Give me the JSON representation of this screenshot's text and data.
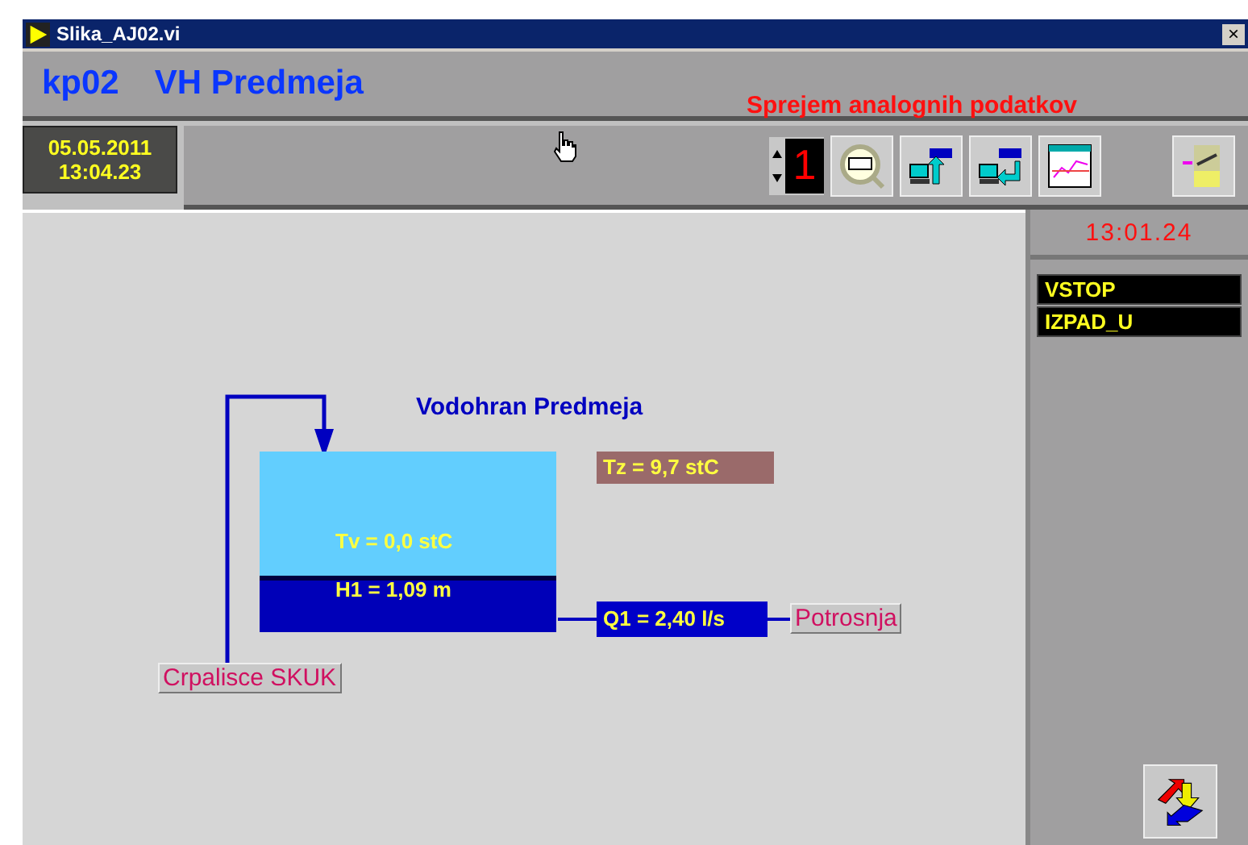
{
  "window": {
    "title": "Slika_AJ02.vi",
    "close": "×"
  },
  "header": {
    "code": "kp02",
    "station": "VH Predmeja",
    "mode": "Sprejem analognih podatkov"
  },
  "datetime": {
    "date": "05.05.2011",
    "time": "13:04.23"
  },
  "toolbar": {
    "counter": "1"
  },
  "side": {
    "time": "13:01.24",
    "alarms": [
      {
        "label": "VSTOP"
      },
      {
        "label": "IZPAD_U"
      }
    ]
  },
  "diagram": {
    "title": "Vodohran Predmeja",
    "tank": {
      "temp": "Tv = 0,0 stC",
      "height": "H1 = 1,09 m"
    },
    "air_temp": "Tz = 9,7 stC",
    "flow": "Q1 = 2,40 l/s",
    "source": "Crpalisce SKUK",
    "consumer": "Potrosnja"
  }
}
